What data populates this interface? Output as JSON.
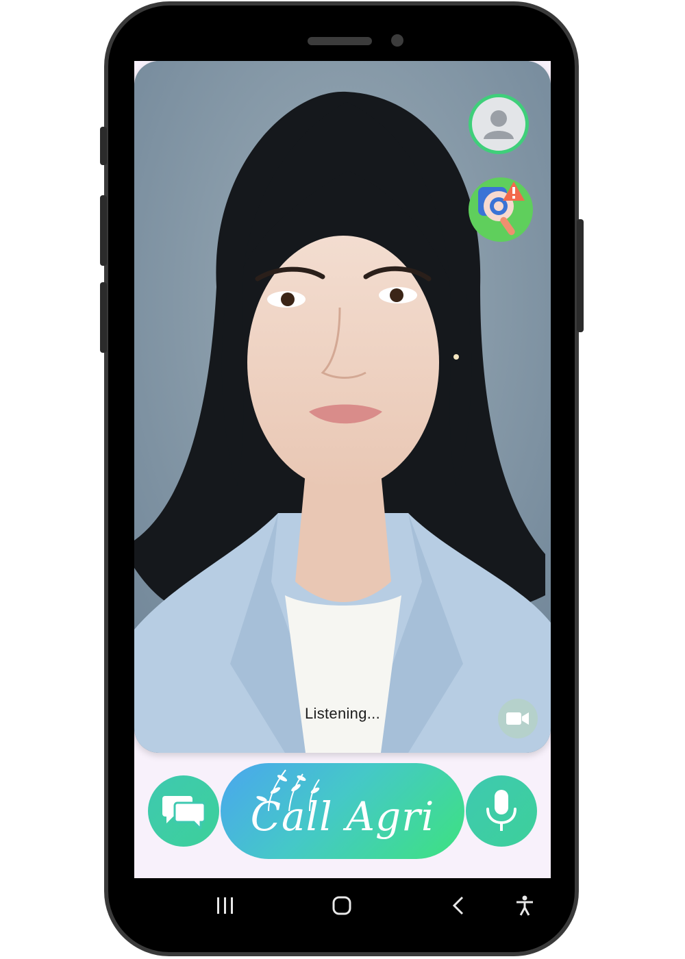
{
  "call": {
    "status": "Listening...",
    "brand_label": "Call Agri"
  },
  "icons": {
    "avatar": "user-avatar-icon",
    "report": "report-issue-icon",
    "video": "video-camera-icon",
    "chat": "chat-bubbles-icon",
    "mic": "microphone-icon",
    "nav_recent": "recent-apps-icon",
    "nav_home": "home-icon",
    "nav_back": "back-icon",
    "nav_accessibility": "accessibility-icon"
  },
  "colors": {
    "accent_green": "#3dd09a",
    "accent_blue": "#4aa6ee",
    "screen_bg": "#f8f1fb"
  }
}
